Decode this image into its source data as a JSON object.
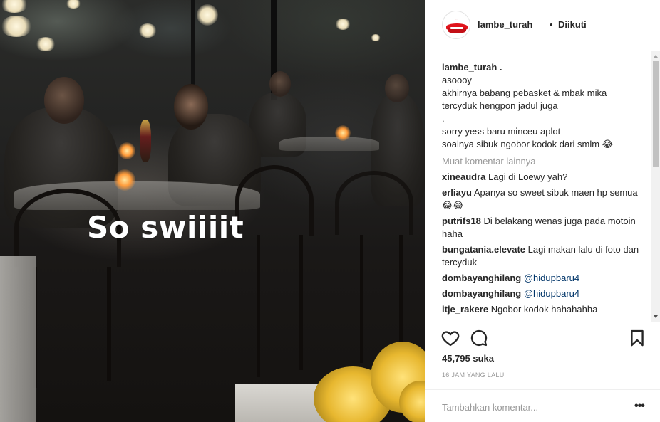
{
  "photo": {
    "overlay_text": "So swiiiit"
  },
  "header": {
    "username": "lambe_turah",
    "separator": "•",
    "follow_status": "Diikuti"
  },
  "caption": {
    "username": "lambe_turah .",
    "lines": [
      "asoooy",
      "akhirnya babang pebasket & mbak mika",
      "tercyduk hengpon jadul juga",
      ".",
      "sorry yess baru minceu aplot",
      "soalnya sibuk ngobor kodok dari smlm 😂"
    ]
  },
  "load_more": "Muat komentar lainnya",
  "comments": [
    {
      "user": "xineaudra",
      "text": "Lagi di Loewy yah?"
    },
    {
      "user": "erliayu",
      "text": "Apanya so sweet sibuk maen hp semua 😂😂"
    },
    {
      "user": "putrifs18",
      "text": "Di belakang wenas juga pada motoin haha"
    },
    {
      "user": "bungatania.elevate",
      "text": "Lagi makan lalu di foto dan tercyduk"
    },
    {
      "user": "dombayanghilang",
      "text": "@hidupbaru4"
    },
    {
      "user": "dombayanghilang",
      "text": "@hidupbaru4"
    },
    {
      "user": "itje_rakere",
      "text": "Ngobor kodok hahahahha"
    }
  ],
  "actions": {
    "like_icon": "heart-outline-icon",
    "comment_icon": "speech-bubble-icon",
    "save_icon": "bookmark-outline-icon",
    "likes": "45,795 suka",
    "time": "16 JAM YANG LALU",
    "add_comment_placeholder": "Tambahkan komentar...",
    "more_options": "•••"
  },
  "colors": {
    "text": "#262626",
    "muted": "#999999",
    "mention": "#003569",
    "border": "#efefef"
  }
}
